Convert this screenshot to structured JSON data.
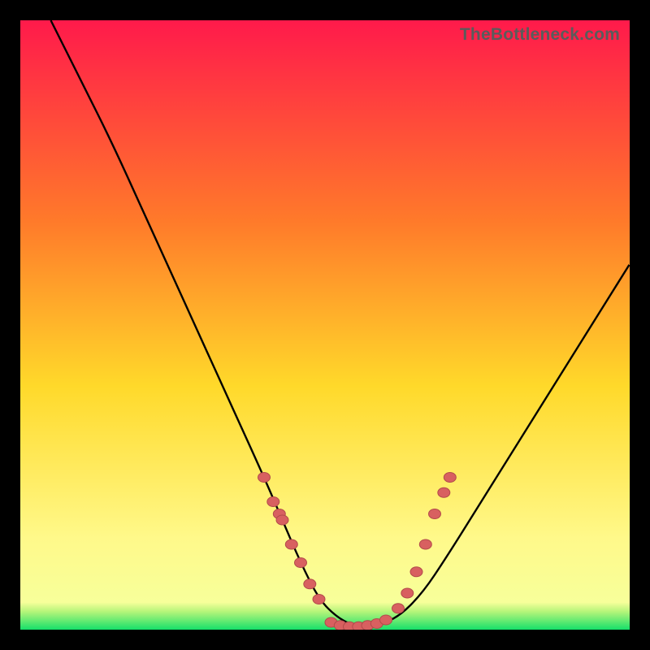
{
  "watermark": "TheBottleneck.com",
  "colors": {
    "bg": "#000000",
    "grad_top": "#ff1a4b",
    "grad_mid1": "#ff7a2a",
    "grad_mid2": "#ffd92a",
    "grad_low": "#fff98a",
    "grad_bottom": "#16e06a",
    "curve": "#000000",
    "dot_fill": "#d86060",
    "dot_stroke": "#b24a4a"
  },
  "chart_data": {
    "type": "line",
    "title": "",
    "xlabel": "",
    "ylabel": "",
    "xlim": [
      0,
      100
    ],
    "ylim": [
      0,
      100
    ],
    "series": [
      {
        "name": "bottleneck-curve",
        "x": [
          5,
          10,
          15,
          20,
          25,
          30,
          35,
          40,
          43,
          46,
          49,
          52,
          55,
          58,
          62,
          66,
          70,
          75,
          80,
          85,
          90,
          95,
          100
        ],
        "y": [
          100,
          90,
          80,
          69,
          58,
          47,
          36,
          25,
          18,
          11,
          5,
          2,
          0.5,
          0.5,
          2,
          6,
          12,
          20,
          28,
          36,
          44,
          52,
          60
        ]
      }
    ],
    "points": [
      {
        "name": "left-cluster",
        "x": [
          40,
          41.5,
          42.5,
          43,
          44.5,
          46,
          47.5,
          49
        ],
        "y": [
          25,
          21,
          19,
          18,
          14,
          11,
          7.5,
          5
        ]
      },
      {
        "name": "bottom-cluster",
        "x": [
          51,
          52.5,
          54,
          55.5,
          57,
          58.5,
          60
        ],
        "y": [
          1.2,
          0.7,
          0.5,
          0.5,
          0.7,
          1.0,
          1.6
        ]
      },
      {
        "name": "right-cluster",
        "x": [
          62,
          63.5,
          65,
          66.5,
          68
        ],
        "y": [
          3.5,
          6,
          9.5,
          14,
          19
        ]
      },
      {
        "name": "right-outlier",
        "x": [
          69.5,
          70.5
        ],
        "y": [
          22.5,
          25
        ]
      }
    ]
  }
}
